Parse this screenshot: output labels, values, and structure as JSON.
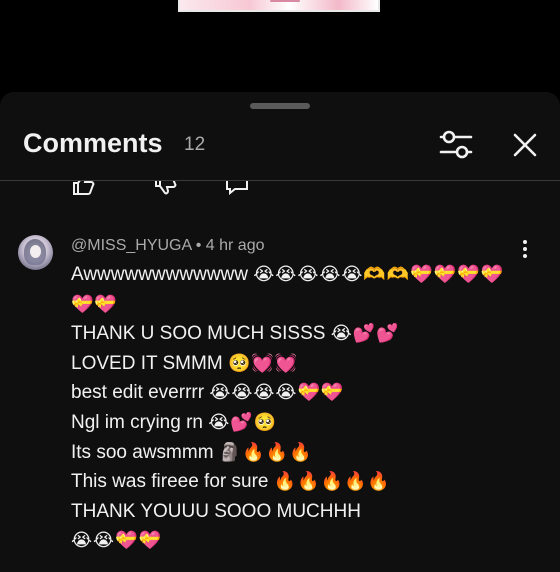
{
  "header": {
    "title": "Comments",
    "count": "12"
  },
  "comment": {
    "author": "@MISS_HYUGA",
    "time": "4 hr ago",
    "lines": [
      {
        "text": "Awwwwwwwwwwww",
        "emoji": "😭😭😭😭😭🫶🫶💝💝💝💝"
      },
      {
        "text": "",
        "emoji": "💝💝"
      },
      {
        "text": "THANK U SOO MUCH SISSS",
        "emoji": "😭💕💕"
      },
      {
        "text": "LOVED IT SMMM",
        "emoji": "🥺💓💓"
      },
      {
        "text": "best edit everrrr",
        "emoji": "😭😭😭😭💝💝"
      },
      {
        "text": "Ngl im crying rn",
        "emoji": "😭💕🥺"
      },
      {
        "text": "Its soo awsmmm",
        "emoji": "🗿🔥🔥🔥"
      },
      {
        "text": "This was fireee for sure",
        "emoji": "🔥🔥🔥🔥🔥"
      },
      {
        "text": "THANK YOUUU SOOO MUCHHH",
        "emoji": ""
      },
      {
        "text": "",
        "emoji": "😭😭💝💝"
      }
    ]
  },
  "icons": {
    "filter": "sliders-icon",
    "close": "close-icon",
    "more": "more-vert-icon",
    "like": "thumb-up-icon",
    "dislike": "thumb-down-icon",
    "reply": "reply-icon"
  },
  "colors": {
    "background": "#0f0f0f",
    "text": "#f1f1f1",
    "secondary": "#aaaaaa"
  }
}
